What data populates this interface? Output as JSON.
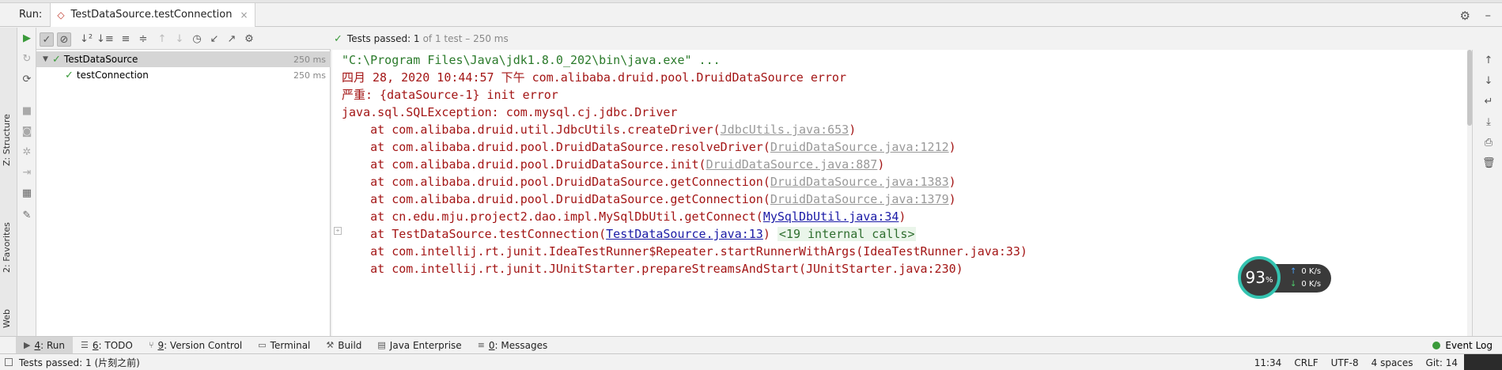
{
  "run_header": {
    "label": "Run:",
    "tab_title": "TestDataSource.testConnection",
    "close": "×"
  },
  "left_stripe": {
    "structure": "Z: Structure",
    "favorites": "2: Favorites",
    "web": "Web"
  },
  "summary": {
    "main": "Tests passed: 1",
    "sub": "of 1 test – 250 ms"
  },
  "tree": {
    "items": [
      {
        "label": "TestDataSource",
        "time": "250 ms"
      },
      {
        "label": "testConnection",
        "time": "250 ms"
      }
    ]
  },
  "console": {
    "line0": "\"C:\\Program Files\\Java\\jdk1.8.0_202\\bin\\java.exe\" ...",
    "line1": "四月 28, 2020 10:44:57 下午 com.alibaba.druid.pool.DruidDataSource error",
    "line2": "严重: {dataSource-1} init error",
    "line3": "java.sql.SQLException: com.mysql.cj.jdbc.Driver",
    "frames": [
      {
        "prefix": "    at com.alibaba.druid.util.JdbcUtils.createDriver(",
        "link": "JdbcUtils.java:653",
        "suffix": ")"
      },
      {
        "prefix": "    at com.alibaba.druid.pool.DruidDataSource.resolveDriver(",
        "link": "DruidDataSource.java:1212",
        "suffix": ")"
      },
      {
        "prefix": "    at com.alibaba.druid.pool.DruidDataSource.init(",
        "link": "DruidDataSource.java:887",
        "suffix": ")"
      },
      {
        "prefix": "    at com.alibaba.druid.pool.DruidDataSource.getConnection(",
        "link": "DruidDataSource.java:1383",
        "suffix": ")"
      },
      {
        "prefix": "    at com.alibaba.druid.pool.DruidDataSource.getConnection(",
        "link": "DruidDataSource.java:1379",
        "suffix": ")"
      },
      {
        "prefix": "    at cn.edu.mju.project2.dao.impl.MySqlDbUtil.getConnect(",
        "link": "MySqlDbUtil.java:34",
        "suffix": ")"
      },
      {
        "prefix": "    at TestDataSource.testConnection(",
        "link": "TestDataSource.java:13",
        "suffix": ")",
        "internal": "<19 internal calls>"
      }
    ],
    "line11": "    at com.intellij.rt.junit.IdeaTestRunner$Repeater.startRunnerWithArgs(IdeaTestRunner.java:33)",
    "line12": "    at com.intellij.rt.junit.JUnitStarter.prepareStreamsAndStart(JUnitStarter.java:230)"
  },
  "net_widget": {
    "percent": "93",
    "percent_sign": "%",
    "up": "0 K/s",
    "down": "0 K/s"
  },
  "bottom_tabs": {
    "run_num": "4",
    "run_label": ": Run",
    "todo_num": "6",
    "todo_label": ": TODO",
    "vc_num": "9",
    "vc_label": ": Version Control",
    "terminal": "Terminal",
    "build": "Build",
    "java_ent": "Java Enterprise",
    "msg_num": "0",
    "msg_label": ": Messages",
    "event_log": "Event Log"
  },
  "status_bar": {
    "message": "Tests passed: 1 (片刻之前)",
    "position": "11:34",
    "line_sep": "CRLF",
    "encoding": "UTF-8",
    "indent": "4 spaces",
    "git": "Git: 14"
  },
  "colors": {
    "pass_green": "#3a9a3a",
    "error_red": "#a31515",
    "link_blue": "#1a1aa6",
    "widget_teal": "#34c3b0"
  }
}
